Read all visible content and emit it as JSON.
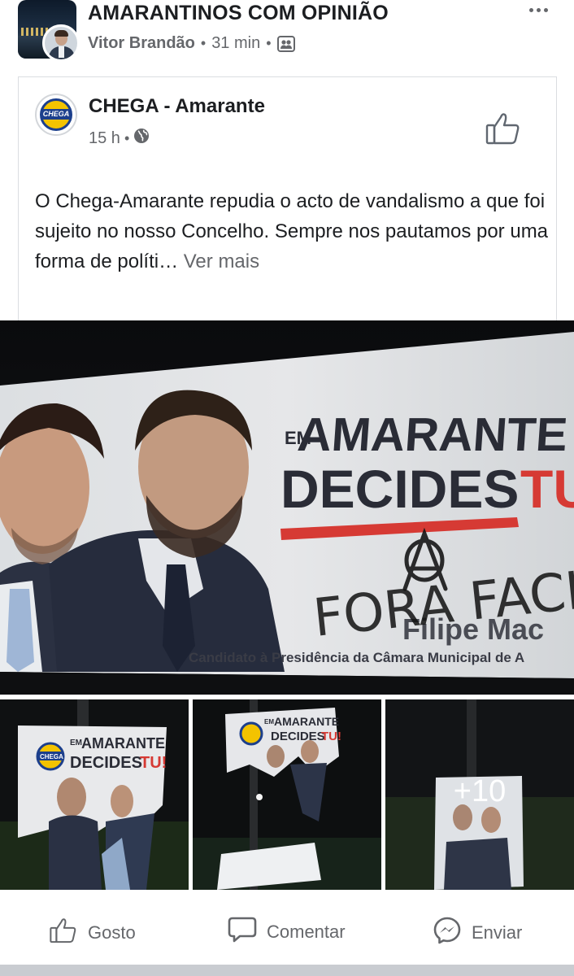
{
  "group": {
    "name": "AMARANTINOS COM OPINIÃO",
    "author": "Vitor Brandão",
    "time": "31 min",
    "separator": "•",
    "privacy_icon": "group-members-icon",
    "more_icon": "more-options-icon"
  },
  "shared_post": {
    "page_name": "CHEGA - Amarante",
    "logo_text": "CHEGA",
    "time": "15 h",
    "separator": "•",
    "audience_icon": "globe-icon",
    "text": "O Chega-Amarante repudia o acto de vandalismo a que foi sujeito no nosso Concelho. Sempre nos pautamos por uma forma de políti…",
    "see_more": "Ver mais"
  },
  "photos": {
    "main": {
      "headline_small": "EM",
      "headline_big": "AMARANTE",
      "headline_line2": "DECIDES",
      "headline_tu": "TU",
      "candidate_name": "Filipe Mac",
      "graffiti": "FORA FACH",
      "subtitle": "Candidato à Presidência da Câmara Municipal de A"
    },
    "thumb1": {
      "small": "EM",
      "big": "AMARANTE",
      "line2": "DECIDES",
      "tu": "TU!",
      "logo": "CHEGA"
    },
    "thumb2": {
      "small": "EM",
      "big": "AMARANTE",
      "line2": "DECIDES",
      "tu": "TU!"
    },
    "more_count": "+10"
  },
  "actions": {
    "like": "Gosto",
    "comment": "Comentar",
    "send": "Enviar"
  },
  "colors": {
    "brand_blue": "#1c3f8c",
    "brand_yellow": "#f3c300",
    "accent_red": "#d63a34",
    "meta_gray": "#65676b"
  }
}
